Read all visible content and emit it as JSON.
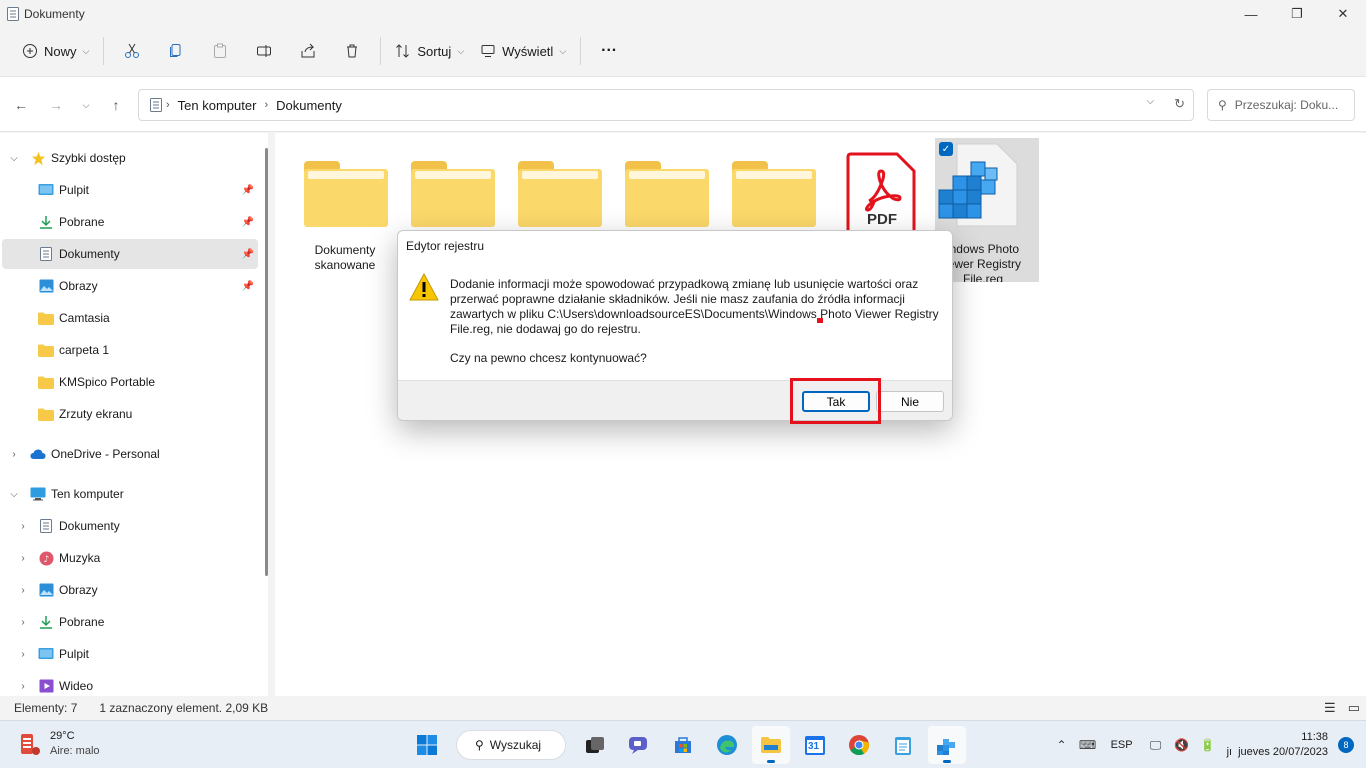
{
  "window": {
    "title": "Dokumenty"
  },
  "commandbar": {
    "new_label": "Nowy",
    "sort_label": "Sortuj",
    "view_label": "Wyświetl",
    "more_label": "···"
  },
  "address": {
    "crumbs": [
      "Ten komputer",
      "Dokumenty"
    ],
    "search_placeholder": "Przeszukaj: Doku..."
  },
  "sidebar": {
    "quick_access": "Szybki dostęp",
    "items": [
      {
        "label": "Pulpit",
        "pinned": true
      },
      {
        "label": "Pobrane",
        "pinned": true
      },
      {
        "label": "Dokumenty",
        "pinned": true,
        "selected": true
      },
      {
        "label": "Obrazy",
        "pinned": true
      },
      {
        "label": "Camtasia"
      },
      {
        "label": "carpeta 1"
      },
      {
        "label": "KMSpico Portable"
      },
      {
        "label": "Zrzuty ekranu"
      }
    ],
    "onedrive": "OneDrive - Personal",
    "this_pc": "Ten komputer",
    "pc_items": [
      "Dokumenty",
      "Muzyka",
      "Obrazy",
      "Pobrane",
      "Pulpit",
      "Wideo"
    ]
  },
  "files": [
    {
      "name": "Dokumenty skanowane",
      "kind": "folder"
    },
    {
      "name": "",
      "kind": "folder"
    },
    {
      "name": "",
      "kind": "folder"
    },
    {
      "name": "",
      "kind": "folder"
    },
    {
      "name": "",
      "kind": "folder"
    },
    {
      "name": "",
      "kind": "pdf",
      "badge": "PDF"
    },
    {
      "name": "Windows Photo Viewer Registry File.reg",
      "kind": "reg",
      "selected": true,
      "visible_name_lines": [
        "indows Photo",
        "iewer Registry",
        "File.reg"
      ]
    }
  ],
  "dialog": {
    "title": "Edytor rejestru",
    "message": "Dodanie informacji może spowodować przypadkową zmianę lub usunięcie wartości oraz przerwać poprawne działanie składników. Jeśli nie masz zaufania do źródła informacji zawartych w pliku C:\\Users\\downloadsourceES\\Documents\\Windows Photo Viewer Registry File.reg, nie dodawaj go do rejestru.",
    "message_lines": [
      "Dodanie informacji może spowodować przypadkową zmianę lub usunięcie wartości oraz",
      "przerwać poprawne działanie składników. Jeśli nie masz zaufania do źródła informacji",
      "zawartych w pliku C:\\Users\\downloadsourceES\\Documents\\Windows Photo Viewer Registry",
      "File.reg, nie dodawaj go do rejestru."
    ],
    "question": "Czy na pewno chcesz kontynuować?",
    "yes_label": "Tak",
    "no_label": "Nie"
  },
  "status": {
    "count": "Elementy: 7",
    "selection": "1 zaznaczony element. 2,09 KB"
  },
  "taskbar": {
    "temp": "29°C",
    "air": "Aire: malo",
    "search_label": "Wyszukaj",
    "lang": "ESP",
    "time": "11:38",
    "date": "jueves 20/07/2023",
    "date_prefix": "jı",
    "notifications": "8",
    "calendar_day": "31"
  },
  "colors": {
    "accent": "#0067c0",
    "folder": "#fbd86a",
    "highlight": "#e3121c",
    "pdf": "#e3121c"
  }
}
